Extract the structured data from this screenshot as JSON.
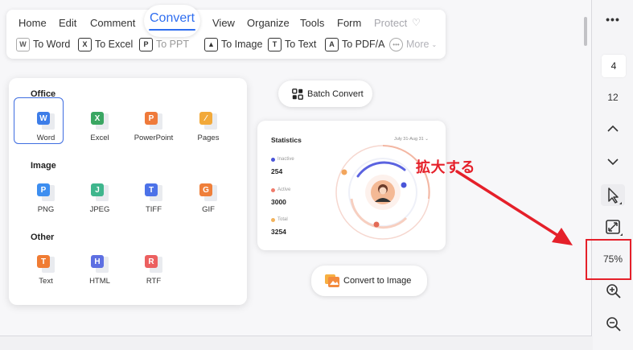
{
  "toolbar": {
    "menu": [
      "Home",
      "Edit",
      "Comment",
      "Convert",
      "View",
      "Organize",
      "Tools",
      "Form",
      "Protect"
    ],
    "active_tab": "Convert",
    "tools": [
      {
        "label": "To Word",
        "glyph": "W"
      },
      {
        "label": "To Excel",
        "glyph": "X"
      },
      {
        "label": "To PPT",
        "glyph": "P"
      },
      {
        "label": "To Image",
        "glyph": "▲"
      },
      {
        "label": "To Text",
        "glyph": "T"
      },
      {
        "label": "To PDF/A",
        "glyph": "A"
      },
      {
        "label": "More",
        "glyph": "•••"
      }
    ]
  },
  "panel": {
    "sections": [
      {
        "title": "Office",
        "items": [
          {
            "label": "Word",
            "glyph": "W",
            "color": "#3d7de8"
          },
          {
            "label": "Excel",
            "glyph": "X",
            "color": "#3aa662"
          },
          {
            "label": "PowerPoint",
            "glyph": "P",
            "color": "#ef7a3a"
          },
          {
            "label": "Pages",
            "glyph": "⁄",
            "color": "#f2a93a"
          }
        ]
      },
      {
        "title": "Image",
        "items": [
          {
            "label": "PNG",
            "glyph": "P",
            "color": "#3d8ef0"
          },
          {
            "label": "JPEG",
            "glyph": "J",
            "color": "#3fb68d"
          },
          {
            "label": "TIFF",
            "glyph": "T",
            "color": "#4c72e8"
          },
          {
            "label": "GIF",
            "glyph": "G",
            "color": "#ef7f3a"
          }
        ]
      },
      {
        "title": "Other",
        "items": [
          {
            "label": "Text",
            "glyph": "T",
            "color": "#f07c34"
          },
          {
            "label": "HTML",
            "glyph": "H",
            "color": "#5d6fe2"
          },
          {
            "label": "RTF",
            "glyph": "R",
            "color": "#ec6060"
          }
        ]
      }
    ],
    "selected": "Word"
  },
  "batch_convert": {
    "label": "Batch Convert"
  },
  "stats": {
    "title": "Statistics",
    "date": "July 31-Aug 31",
    "rows": [
      {
        "key": "Inactive",
        "value": "254",
        "color": "#4a55d8"
      },
      {
        "key": "Active",
        "value": "3000",
        "color": "#f07b6b"
      },
      {
        "key": "Total",
        "value": "3254",
        "color": "#f2b35c"
      }
    ]
  },
  "convert_to_image": {
    "label": "Convert to Image"
  },
  "annotation": {
    "text": "拡大する"
  },
  "rightbar": {
    "more": "•••",
    "current_page": "4",
    "total_pages": "12",
    "zoom": "75%"
  }
}
